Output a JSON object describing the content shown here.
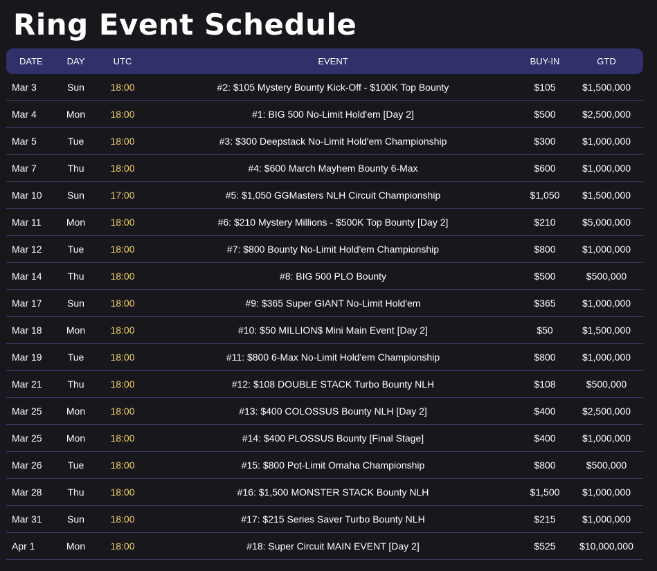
{
  "title": "Ring Event Schedule",
  "colors": {
    "background": "#18171c",
    "header_bg": "#30306a",
    "row_divider": "#3a3a6a",
    "time_accent": "#f2d26a",
    "text": "#ffffff"
  },
  "headers": {
    "date": "DATE",
    "day": "DAY",
    "utc": "UTC",
    "event": "EVENT",
    "buyin": "BUY-IN",
    "gtd": "GTD"
  },
  "rows": [
    {
      "date": "Mar 3",
      "day": "Sun",
      "utc": "18:00",
      "event": "#2: $105 Mystery Bounty Kick-Off - $100K Top Bounty",
      "buyin": "$105",
      "gtd": "$1,500,000"
    },
    {
      "date": "Mar 4",
      "day": "Mon",
      "utc": "18:00",
      "event": "#1: BIG 500 No-Limit Hold'em [Day 2]",
      "buyin": "$500",
      "gtd": "$2,500,000"
    },
    {
      "date": "Mar 5",
      "day": "Tue",
      "utc": "18:00",
      "event": "#3: $300 Deepstack No-Limit Hold'em Championship",
      "buyin": "$300",
      "gtd": "$1,000,000"
    },
    {
      "date": "Mar 7",
      "day": "Thu",
      "utc": "18:00",
      "event": "#4: $600 March Mayhem Bounty 6-Max",
      "buyin": "$600",
      "gtd": "$1,000,000"
    },
    {
      "date": "Mar 10",
      "day": "Sun",
      "utc": "17:00",
      "event": "#5: $1,050 GGMasters NLH Circuit Championship",
      "buyin": "$1,050",
      "gtd": "$1,500,000"
    },
    {
      "date": "Mar 11",
      "day": "Mon",
      "utc": "18:00",
      "event": "#6: $210 Mystery Millions - $500K Top Bounty [Day 2]",
      "buyin": "$210",
      "gtd": "$5,000,000"
    },
    {
      "date": "Mar 12",
      "day": "Tue",
      "utc": "18:00",
      "event": "#7: $800 Bounty No-Limit Hold'em Championship",
      "buyin": "$800",
      "gtd": "$1,000,000"
    },
    {
      "date": "Mar 14",
      "day": "Thu",
      "utc": "18:00",
      "event": "#8: BIG 500 PLO Bounty",
      "buyin": "$500",
      "gtd": "$500,000"
    },
    {
      "date": "Mar 17",
      "day": "Sun",
      "utc": "18:00",
      "event": "#9: $365 Super GIANT No-Limit Hold'em",
      "buyin": "$365",
      "gtd": "$1,000,000"
    },
    {
      "date": "Mar 18",
      "day": "Mon",
      "utc": "18:00",
      "event": "#10: $50 MILLION$ Mini Main Event [Day 2]",
      "buyin": "$50",
      "gtd": "$1,500,000"
    },
    {
      "date": "Mar 19",
      "day": "Tue",
      "utc": "18:00",
      "event": "#11: $800 6-Max No-Limit Hold'em Championship",
      "buyin": "$800",
      "gtd": "$1,000,000"
    },
    {
      "date": "Mar 21",
      "day": "Thu",
      "utc": "18:00",
      "event": "#12: $108 DOUBLE STACK Turbo Bounty NLH",
      "buyin": "$108",
      "gtd": "$500,000"
    },
    {
      "date": "Mar 25",
      "day": "Mon",
      "utc": "18:00",
      "event": "#13: $400 COLOSSUS Bounty NLH [Day 2]",
      "buyin": "$400",
      "gtd": "$2,500,000"
    },
    {
      "date": "Mar 25",
      "day": "Mon",
      "utc": "18:00",
      "event": "#14: $400 PLOSSUS Bounty [Final Stage]",
      "buyin": "$400",
      "gtd": "$1,000,000"
    },
    {
      "date": "Mar 26",
      "day": "Tue",
      "utc": "18:00",
      "event": "#15: $800 Pot-Limit Omaha Championship",
      "buyin": "$800",
      "gtd": "$500,000"
    },
    {
      "date": "Mar 28",
      "day": "Thu",
      "utc": "18:00",
      "event": "#16: $1,500 MONSTER STACK Bounty NLH",
      "buyin": "$1,500",
      "gtd": "$1,000,000"
    },
    {
      "date": "Mar 31",
      "day": "Sun",
      "utc": "18:00",
      "event": "#17: $215 Series Saver Turbo Bounty NLH",
      "buyin": "$215",
      "gtd": "$1,000,000"
    },
    {
      "date": "Apr 1",
      "day": "Mon",
      "utc": "18:00",
      "event": "#18: Super Circuit MAIN EVENT [Day 2]",
      "buyin": "$525",
      "gtd": "$10,000,000"
    }
  ]
}
